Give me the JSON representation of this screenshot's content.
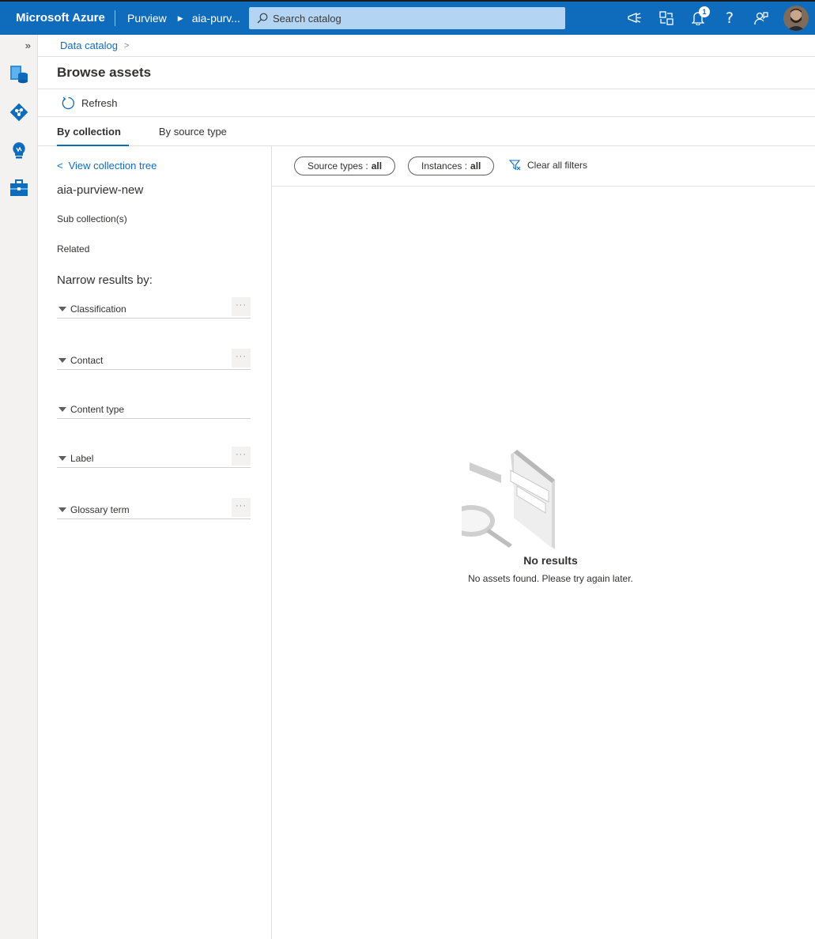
{
  "topbar": {
    "brand": "Microsoft Azure",
    "crumbs": [
      "Purview",
      "aia-purv..."
    ],
    "search_placeholder": "Search catalog",
    "notification_count": "1",
    "accent": "#0f6cbd",
    "icons": [
      "feedback-icon",
      "directory-switch-icon",
      "bell-icon",
      "help-icon",
      "person-feedback-icon",
      "avatar"
    ]
  },
  "rail": {
    "expand_label": "»",
    "items": [
      "data-catalog-icon",
      "data-map-icon",
      "insights-icon",
      "management-icon"
    ]
  },
  "breadcrumb": {
    "item": "Data catalog"
  },
  "page": {
    "title": "Browse assets",
    "refresh_label": "Refresh",
    "tabs": [
      "By collection",
      "By source type"
    ],
    "active_tab": "By collection"
  },
  "left": {
    "back_link": "View collection tree",
    "collection_name": "aia-purview-new",
    "sub_collections": "Sub collection(s)",
    "related": "Related",
    "narrow_heading": "Narrow results by:",
    "facets": [
      "Classification",
      "Contact",
      "Content type",
      "Label",
      "Glossary term"
    ],
    "more_label": "···"
  },
  "filters": {
    "source_types_label": "Source types :",
    "source_types_value": "all",
    "instances_label": "Instances :",
    "instances_value": "all",
    "clear_label": "Clear all filters"
  },
  "empty_state": {
    "title": "No results",
    "subtitle": "No assets found. Please try again later."
  }
}
